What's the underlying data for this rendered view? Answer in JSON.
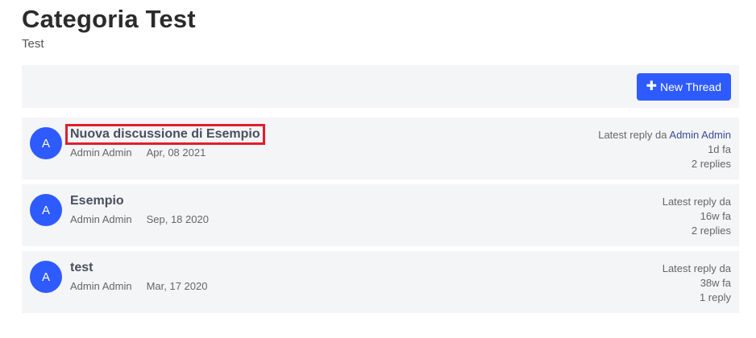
{
  "category": {
    "title": "Categoria Test",
    "subtitle": "Test"
  },
  "toolbar": {
    "new_thread_label": "New Thread",
    "new_thread_icon": "plus-icon"
  },
  "colors": {
    "accent": "#2e5bff",
    "highlight": "#e01e2b",
    "panel_bg": "#f4f5f7"
  },
  "threads": [
    {
      "avatar": "A",
      "title": "Nuova discussione di Esempio",
      "author": "Admin Admin",
      "date": "Apr, 08 2021",
      "latest_reply_label": "Latest reply da",
      "latest_reply_author": "Admin Admin",
      "ago": "1d fa",
      "replies": "2 replies"
    },
    {
      "avatar": "A",
      "title": "Esempio",
      "author": "Admin Admin",
      "date": "Sep, 18 2020",
      "latest_reply_label": "Latest reply da",
      "ago": "16w fa",
      "replies": "2 replies"
    },
    {
      "avatar": "A",
      "title": "test",
      "author": "Admin Admin",
      "date": "Mar, 17 2020",
      "latest_reply_label": "Latest reply da",
      "ago": "38w fa",
      "replies": "1 reply"
    }
  ]
}
